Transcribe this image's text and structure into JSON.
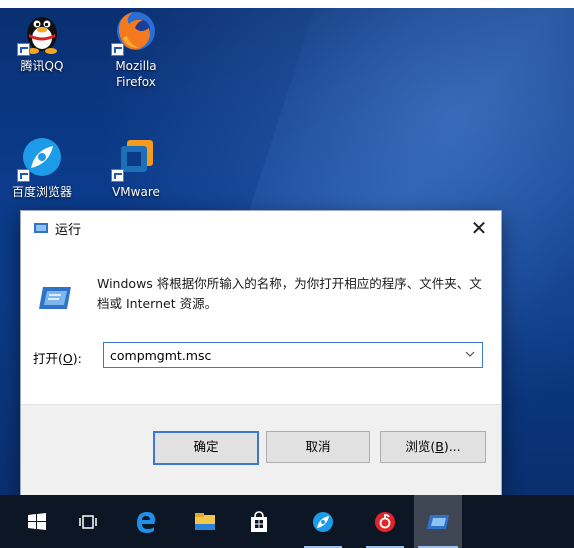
{
  "desktop": {
    "icons": [
      {
        "label": "腾讯QQ",
        "icon": "qq-penguin-icon"
      },
      {
        "label": "Mozilla Firefox",
        "icon": "firefox-icon"
      },
      {
        "label": "百度浏览器",
        "icon": "baidu-browser-icon"
      },
      {
        "label": "VMware",
        "icon": "vmware-icon"
      }
    ]
  },
  "dialog": {
    "title": "运行",
    "description": "Windows 将根据你所输入的名称，为你打开相应的程序、文件夹、文档或 Internet 资源。",
    "open_label_prefix": "打开(",
    "open_label_key": "O",
    "open_label_suffix": "):",
    "command_value": "compmgmt.msc",
    "buttons": {
      "ok": "确定",
      "cancel": "取消",
      "browse_prefix": "浏览(",
      "browse_key": "B",
      "browse_suffix": ")..."
    },
    "close_glyph": "✕"
  },
  "taskbar": {
    "items": [
      "start-icon",
      "task-view-icon",
      "edge-icon",
      "file-explorer-icon",
      "store-icon",
      "baidu-browser-icon",
      "netease-music-icon",
      "run-icon"
    ],
    "active": "run-icon"
  },
  "colors": {
    "accent": "#3a78d4",
    "taskbar": "#0c1624",
    "desktop": "#0b3a86"
  }
}
